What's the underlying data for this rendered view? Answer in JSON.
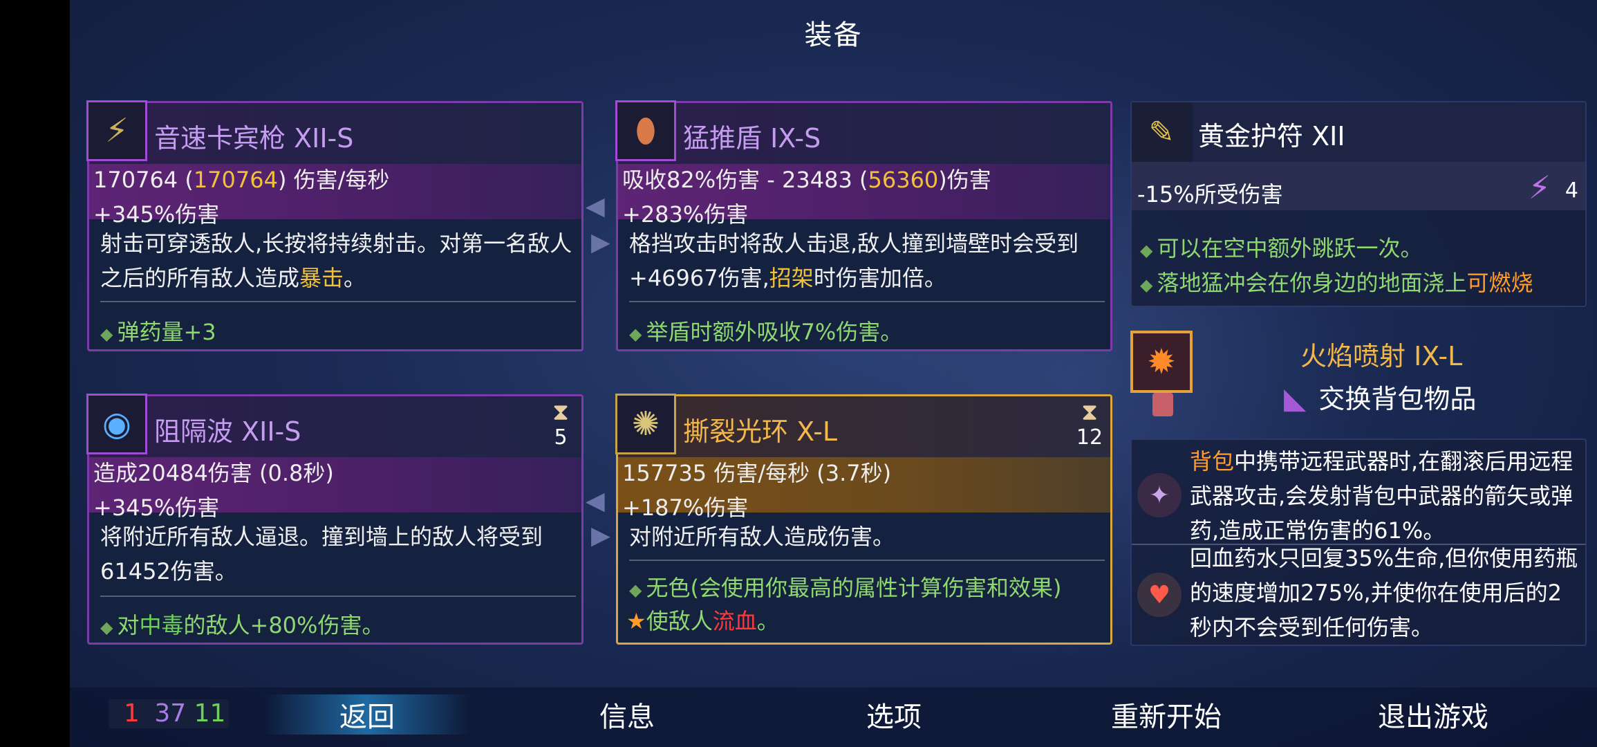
{
  "header": {
    "title": "装备"
  },
  "colors": {
    "accent_purple": "#7e3aa8",
    "accent_gold": "#d8a93a",
    "highlight": "#f2c13a",
    "positive": "#8fd870",
    "bleed": "#ff3a3a"
  },
  "items": [
    {
      "name": "音速卡宾枪 XII-S",
      "icon": "carbine-icon",
      "stat_prefix": "170764 (",
      "stat_hl": "170764",
      "stat_suffix": ") 伤害/每秒",
      "bonus_line": "+345%伤害",
      "desc_pre": "射击可穿透敌人,长按将持续射击。对第一名敌人之后的所有敌人造成",
      "desc_hl": "暴击",
      "desc_post": "。",
      "affix": "弹药量+3"
    },
    {
      "name": "猛推盾 IX-S",
      "icon": "shield-icon",
      "stat_prefix": "吸收82%伤害 - 23483 (",
      "stat_hl": "56360",
      "stat_suffix": ")伤害",
      "bonus_line": "+283%伤害",
      "desc_pre": "格挡攻击时将敌人击退,敌人撞到墙壁时会受到+46967伤害,",
      "desc_hl": "招架",
      "desc_post": "时伤害加倍。",
      "affix": "举盾时额外吸收7%伤害。"
    },
    {
      "name": "阻隔波 XII-S",
      "icon": "wave-icon",
      "cooldown": "5",
      "stat": "造成20484伤害 (0.8秒)",
      "bonus_line": "+345%伤害",
      "desc": "将附近所有敌人逼退。撞到墙上的敌人将受到61452伤害。",
      "affix_pre": "对",
      "affix_hl": "中毒",
      "affix_post": "的敌人+80%伤害。"
    },
    {
      "name": "撕裂光环 X-L",
      "icon": "aura-icon",
      "cooldown": "12",
      "stat": "157735 伤害/每秒 (3.7秒)",
      "bonus_line": "+187%伤害",
      "desc": "对附近所有敌人造成伤害。",
      "affix": "无色(会使用你最高的属性计算伤害和效果)",
      "affix2_pre": "使敌人",
      "affix2_hl": "流血",
      "affix2_post": "。"
    }
  ],
  "amulet": {
    "name": "黄金护符 XII",
    "stat": "-15%所受伤害",
    "scroll_count": "4",
    "perk1": "可以在空中额外跳跃一次。",
    "perk2_pre": "落地猛冲会在你身边的地面浇上",
    "perk2_hl": "可燃烧"
  },
  "skill": {
    "name": "火焰喷射 IX-L",
    "swap_label": "交换背包物品"
  },
  "mutations": [
    {
      "icon": "backpack-icon",
      "text_hl": "背包",
      "text": "中携带远程武器时,在翻滚后用远程武器攻击,会发射背包中武器的箭矢或弹药,造成正常伤害的61%。"
    },
    {
      "icon": "potion-icon",
      "text": "回血药水只回复35%生命,但你使用药瓶的速度增加275%,并使你在使用后的2秒内不会受到任何伤害。"
    }
  ],
  "stats": {
    "brutality": "1",
    "tactics": "37",
    "survival": "11"
  },
  "menu": {
    "back": "返回",
    "info": "信息",
    "options": "选项",
    "restart": "重新开始",
    "quit": "退出游戏"
  }
}
